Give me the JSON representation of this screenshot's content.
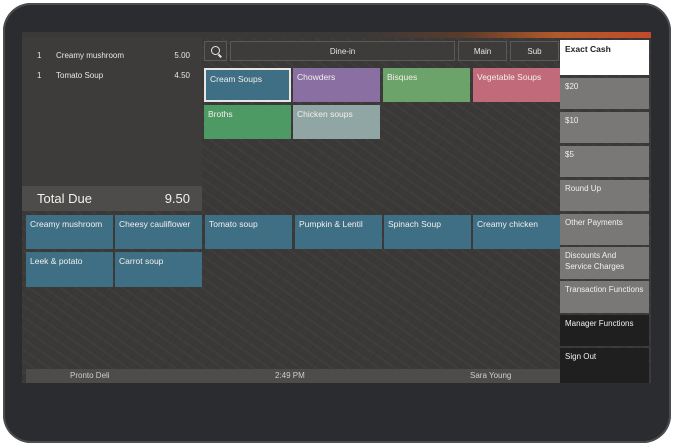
{
  "order": {
    "items": [
      {
        "qty": "1",
        "name": "Creamy mushroom",
        "price": "5.00"
      },
      {
        "qty": "1",
        "name": "Tomato Soup",
        "price": "4.50"
      }
    ],
    "total_label": "Total Due",
    "total_value": "9.50"
  },
  "topbar": {
    "search_icon": "search-icon",
    "order_type": "Dine-in",
    "main_label": "Main",
    "sub_label": "Sub"
  },
  "categories": [
    "Cream Soups",
    "Chowders",
    "Bisques",
    "Vegetable Soups",
    "Broths",
    "Chicken soups"
  ],
  "items": [
    "Creamy mushroom",
    "Cheesy cauliflower",
    "Tomato soup",
    "Pumpkin & Lentil",
    "Spinach Soup",
    "Creamy chicken",
    "Leek & potato",
    "Carrot soup"
  ],
  "payments": {
    "exact_cash": "Exact Cash",
    "twenty": "$20",
    "ten": "$10",
    "five": "$5",
    "round_up": "Round Up",
    "other_payments": "Other Payments",
    "discounts": "Discounts And Service Charges",
    "transaction_functions": "Transaction Functions",
    "manager_functions": "Manager Functions",
    "sign_out": "Sign Out"
  },
  "status": {
    "location": "Pronto Deli",
    "time": "2:49 PM",
    "user": "Sara Young"
  },
  "colors": {
    "selected_category": "#3f6f84",
    "chowders": "#8a6fa3",
    "bisques": "#6ca36a",
    "vegetable_soups": "#c06a7a",
    "broths": "#4e9a64",
    "chicken_soups": "#8fa6a4",
    "item": "#3f6f84"
  }
}
